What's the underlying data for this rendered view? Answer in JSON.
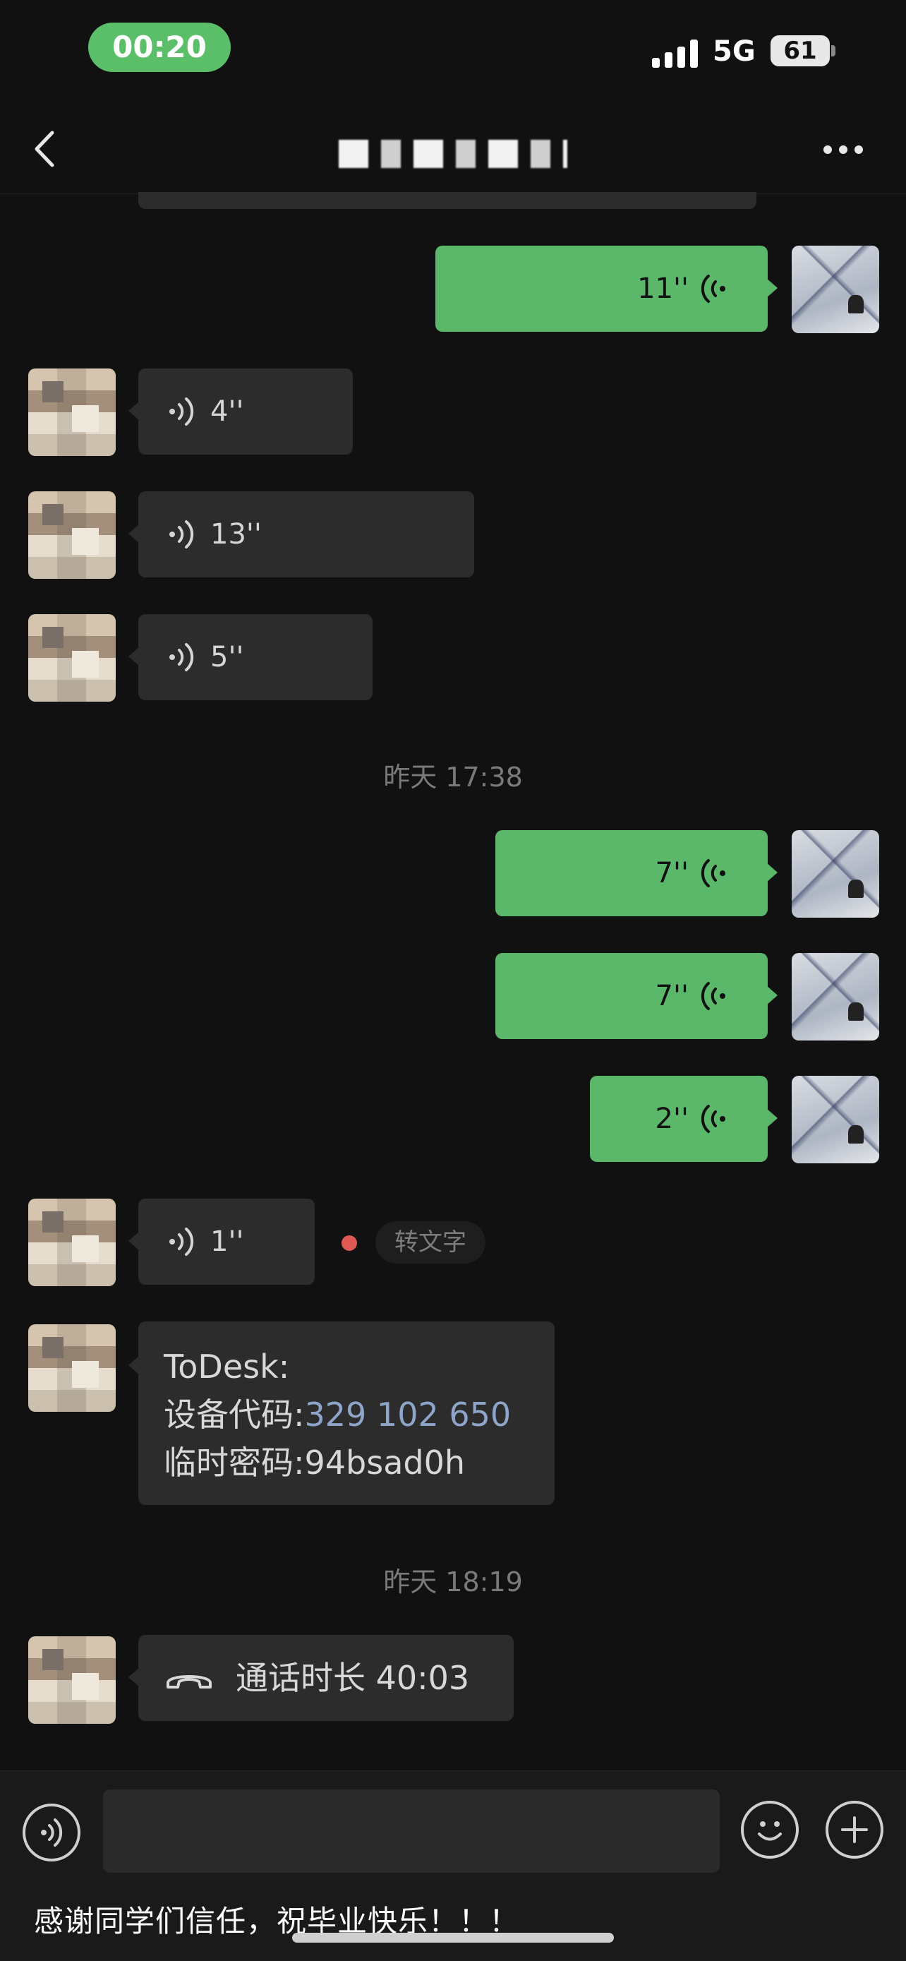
{
  "status_bar": {
    "time": "00:20",
    "network": "5G",
    "battery": "61"
  },
  "header": {
    "title": "",
    "back_icon": "chevron-left-icon",
    "more_icon": "ellipsis-icon"
  },
  "messages": [
    {
      "sender": "me",
      "type": "voice",
      "duration": "11''"
    },
    {
      "sender": "other",
      "type": "voice",
      "duration": "4''"
    },
    {
      "sender": "other",
      "type": "voice",
      "duration": "13''"
    },
    {
      "sender": "other",
      "type": "voice",
      "duration": "5''"
    },
    {
      "type": "timestamp",
      "text": "昨天 17:38"
    },
    {
      "sender": "me",
      "type": "voice",
      "duration": "7''"
    },
    {
      "sender": "me",
      "type": "voice",
      "duration": "7''"
    },
    {
      "sender": "me",
      "type": "voice",
      "duration": "2''"
    },
    {
      "sender": "other",
      "type": "voice",
      "duration": "1''",
      "unread": true,
      "to_text_label": "转文字"
    },
    {
      "sender": "other",
      "type": "text",
      "line1": "ToDesk:",
      "line2_label": "设备代码:",
      "line2_value": "329 102 650",
      "line3": "临时密码:94bsad0h"
    },
    {
      "type": "timestamp",
      "text": "昨天 18:19"
    },
    {
      "sender": "other",
      "type": "call",
      "label": "通话时长 40:03"
    }
  ],
  "input_bar": {
    "value": "",
    "voice_icon": "voice-mode-icon",
    "emoji_icon": "emoji-icon",
    "plus_icon": "plus-icon"
  },
  "caption": "感谢同学们信任，祝毕业快乐！！！",
  "colors": {
    "background": "#111111",
    "my_bubble": "#5bb86b",
    "their_bubble": "#2c2c2c",
    "status_time_pill": "#5bbf6a",
    "link": "#8ea4c8",
    "unread_dot": "#e05a55"
  }
}
